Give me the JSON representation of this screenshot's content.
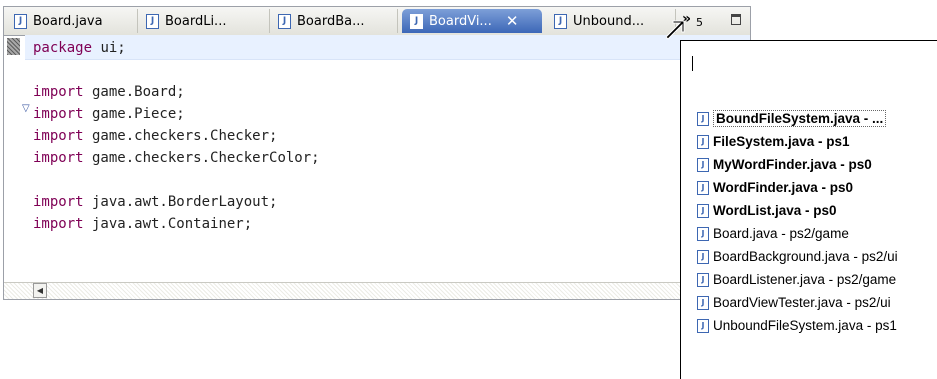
{
  "editor": {
    "tabs": [
      {
        "label": "Board.java",
        "active": false
      },
      {
        "label": "BoardLi...",
        "active": false
      },
      {
        "label": "BoardBa...",
        "active": false
      },
      {
        "label": "BoardVi...",
        "active": true
      },
      {
        "label": "Unbound...",
        "active": false
      }
    ],
    "close_glyph": "✕",
    "overflow": {
      "chevron": "»",
      "count": "5"
    },
    "code_lines": [
      [
        {
          "t": "package",
          "kw": true
        },
        {
          "t": " ui;"
        }
      ],
      [],
      [
        {
          "t": "import",
          "kw": true
        },
        {
          "t": " game.Board;"
        }
      ],
      [
        {
          "t": "import",
          "kw": true
        },
        {
          "t": " game.Piece;"
        }
      ],
      [
        {
          "t": "import",
          "kw": true
        },
        {
          "t": " game.checkers.Checker;"
        }
      ],
      [
        {
          "t": "import",
          "kw": true
        },
        {
          "t": " game.checkers.CheckerColor;"
        }
      ],
      [],
      [
        {
          "t": "import",
          "kw": true
        },
        {
          "t": " java.awt.BorderLayout;"
        }
      ],
      [
        {
          "t": "import",
          "kw": true
        },
        {
          "t": " java.awt.Container;"
        }
      ]
    ],
    "fold_glyph": "▽",
    "scroll_left_glyph": "◀",
    "colors": {
      "keyword": "#7f0055",
      "active_tab": "#3c67b7",
      "current_line": "#e8f1ff"
    }
  },
  "editor_list_popup": {
    "filter_value": "",
    "items": [
      {
        "label": "BoundFileSystem.java - ...",
        "bold": true,
        "selected": true
      },
      {
        "label": "FileSystem.java - ps1",
        "bold": true,
        "selected": false
      },
      {
        "label": "MyWordFinder.java - ps0",
        "bold": true,
        "selected": false
      },
      {
        "label": "WordFinder.java - ps0",
        "bold": true,
        "selected": false
      },
      {
        "label": "WordList.java - ps0",
        "bold": true,
        "selected": false
      },
      {
        "label": "Board.java - ps2/game",
        "bold": false,
        "selected": false
      },
      {
        "label": "BoardBackground.java - ps2/ui",
        "bold": false,
        "selected": false
      },
      {
        "label": "BoardListener.java - ps2/game",
        "bold": false,
        "selected": false
      },
      {
        "label": "BoardViewTester.java - ps2/ui",
        "bold": false,
        "selected": false
      },
      {
        "label": "UnboundFileSystem.java - ps1",
        "bold": false,
        "selected": false
      }
    ]
  },
  "icons": {
    "file_icon": "java-file-icon",
    "pointer": "mouse-pointer-icon"
  }
}
